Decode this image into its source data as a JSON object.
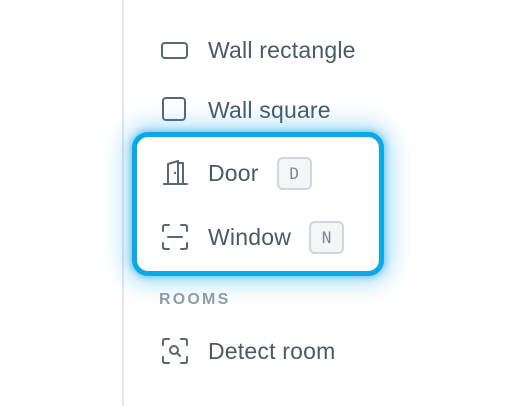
{
  "tools": {
    "wall_rectangle": {
      "label": "Wall rectangle",
      "icon": "rectangle-icon"
    },
    "wall_square": {
      "label": "Wall square",
      "icon": "square-icon"
    },
    "door": {
      "label": "Door",
      "shortcut": "D",
      "icon": "door-icon"
    },
    "window": {
      "label": "Window",
      "shortcut": "N",
      "icon": "window-frame-icon"
    }
  },
  "rooms_section": {
    "title": "ROOMS",
    "items": [
      {
        "label": "Detect room",
        "icon": "scan-search-icon"
      }
    ]
  },
  "colors": {
    "highlight_border": "#0ba8e6",
    "text": "#4a5868",
    "section_title": "#8e9cab"
  }
}
